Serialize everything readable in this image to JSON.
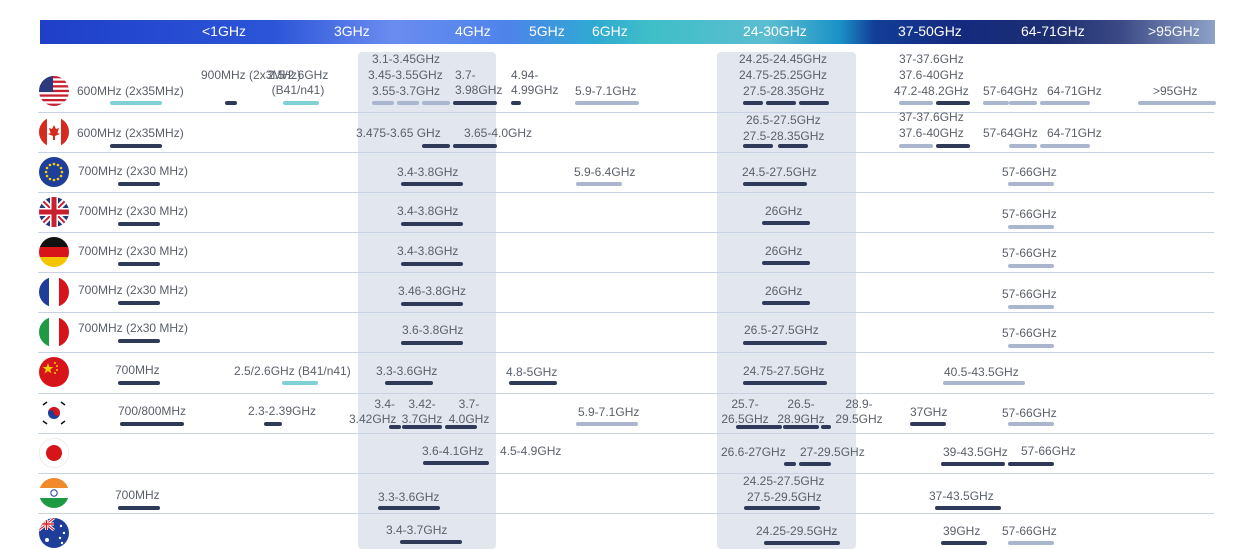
{
  "header": {
    "bands": [
      "<1GHz",
      "3GHz",
      "4GHz",
      "5GHz",
      "6GHz",
      "24-30GHz",
      "37-50GHz",
      "64-71GHz",
      ">95GHz"
    ]
  },
  "colors": {
    "dark_bar": "#2e3a57",
    "light_bar": "#aab6cd",
    "teal_bar": "#7fd1d6",
    "highlight_band": "#e2e7ef"
  },
  "chart_data": {
    "type": "table",
    "rows": [
      {
        "country_flag": "flag-usa-icon",
        "entries": [
          {
            "text": "600MHz (2x35MHz)",
            "tier": "teal"
          },
          {
            "text": "900MHz (2x3MHz)",
            "tier": "dark"
          },
          {
            "text": "2.5/2.6GHz (B41/n41)",
            "tier": "teal"
          },
          {
            "text": "3.1-3.45GHz",
            "tier": "light"
          },
          {
            "text": "3.45-3.55GHz",
            "tier": "light"
          },
          {
            "text": "3.55-3.7GHz",
            "tier": "light"
          },
          {
            "text": "3.7-3.98GHz",
            "tier": "dark"
          },
          {
            "text": "4.94-4.99GHz",
            "tier": "dark"
          },
          {
            "text": "5.9-7.1GHz",
            "tier": "light"
          },
          {
            "text": "24.25-24.45GHz",
            "tier": "dark"
          },
          {
            "text": "24.75-25.25GHz",
            "tier": "dark"
          },
          {
            "text": "27.5-28.35GHz",
            "tier": "dark"
          },
          {
            "text": "37-37.6GHz",
            "tier": "light"
          },
          {
            "text": "37.6-40GHz",
            "tier": "dark"
          },
          {
            "text": "47.2-48.2GHz",
            "tier": "light"
          },
          {
            "text": "57-64GHz",
            "tier": "light"
          },
          {
            "text": "64-71GHz",
            "tier": "light"
          },
          {
            "text": ">95GHz",
            "tier": "light"
          }
        ]
      },
      {
        "country_flag": "flag-canada-icon",
        "entries": [
          {
            "text": "600MHz (2x35MHz)",
            "tier": "dark"
          },
          {
            "text": "3.475-3.65 GHz",
            "tier": "dark"
          },
          {
            "text": "3.65-4.0GHz",
            "tier": "dark"
          },
          {
            "text": "26.5-27.5GHz",
            "tier": "dark"
          },
          {
            "text": "27.5-28.35GHz",
            "tier": "dark"
          },
          {
            "text": "37-37.6GHz",
            "tier": "light"
          },
          {
            "text": "37.6-40GHz",
            "tier": "dark"
          },
          {
            "text": "57-64GHz",
            "tier": "light"
          },
          {
            "text": "64-71GHz",
            "tier": "light"
          }
        ]
      },
      {
        "country_flag": "flag-eu-icon",
        "entries": [
          {
            "text": "700MHz (2x30 MHz)",
            "tier": "dark"
          },
          {
            "text": "3.4-3.8GHz",
            "tier": "dark"
          },
          {
            "text": "5.9-6.4GHz",
            "tier": "light"
          },
          {
            "text": "24.5-27.5GHz",
            "tier": "dark"
          },
          {
            "text": "57-66GHz",
            "tier": "light"
          }
        ]
      },
      {
        "country_flag": "flag-uk-icon",
        "entries": [
          {
            "text": "700MHz (2x30 MHz)",
            "tier": "dark"
          },
          {
            "text": "3.4-3.8GHz",
            "tier": "dark"
          },
          {
            "text": "26GHz",
            "tier": "dark"
          },
          {
            "text": "57-66GHz",
            "tier": "light"
          }
        ]
      },
      {
        "country_flag": "flag-germany-icon",
        "entries": [
          {
            "text": "700MHz (2x30 MHz)",
            "tier": "dark"
          },
          {
            "text": "3.4-3.8GHz",
            "tier": "dark"
          },
          {
            "text": "26GHz",
            "tier": "dark"
          },
          {
            "text": "57-66GHz",
            "tier": "light"
          }
        ]
      },
      {
        "country_flag": "flag-france-icon",
        "entries": [
          {
            "text": "700MHz (2x30 MHz)",
            "tier": "dark"
          },
          {
            "text": "3.46-3.8GHz",
            "tier": "dark"
          },
          {
            "text": "26GHz",
            "tier": "dark"
          },
          {
            "text": "57-66GHz",
            "tier": "light"
          }
        ]
      },
      {
        "country_flag": "flag-italy-icon",
        "entries": [
          {
            "text": "700MHz (2x30 MHz)",
            "tier": "dark"
          },
          {
            "text": "3.6-3.8GHz",
            "tier": "dark"
          },
          {
            "text": "26.5-27.5GHz",
            "tier": "dark"
          },
          {
            "text": "57-66GHz",
            "tier": "light"
          }
        ]
      },
      {
        "country_flag": "flag-china-icon",
        "entries": [
          {
            "text": "700MHz",
            "tier": "dark"
          },
          {
            "text": "2.5/2.6GHz (B41/n41)",
            "tier": "teal"
          },
          {
            "text": "3.3-3.6GHz",
            "tier": "dark"
          },
          {
            "text": "4.8-5GHz",
            "tier": "dark"
          },
          {
            "text": "24.75-27.5GHz",
            "tier": "dark"
          },
          {
            "text": "40.5-43.5GHz",
            "tier": "light"
          }
        ]
      },
      {
        "country_flag": "flag-korea-icon",
        "entries": [
          {
            "text": "700/800MHz",
            "tier": "dark"
          },
          {
            "text": "2.3-2.39GHz",
            "tier": "dark"
          },
          {
            "text": "3.4-3.42GHz",
            "tier": "dark"
          },
          {
            "text": "3.42-3.7GHz",
            "tier": "dark"
          },
          {
            "text": "3.7-4.0GHz",
            "tier": "dark"
          },
          {
            "text": "5.9-7.1GHz",
            "tier": "light"
          },
          {
            "text": "25.7-26.5GHz",
            "tier": "dark"
          },
          {
            "text": "26.5-28.9GHz",
            "tier": "dark"
          },
          {
            "text": "28.9-29.5GHz",
            "tier": "dark"
          },
          {
            "text": "37GHz",
            "tier": "dark"
          },
          {
            "text": "57-66GHz",
            "tier": "light"
          }
        ]
      },
      {
        "country_flag": "flag-japan-icon",
        "entries": [
          {
            "text": "3.6-4.1GHz",
            "tier": "dark"
          },
          {
            "text": "4.5-4.9GHz",
            "tier": "dark"
          },
          {
            "text": "26.6-27GHz",
            "tier": "dark"
          },
          {
            "text": "27-29.5GHz",
            "tier": "dark"
          },
          {
            "text": "39-43.5GHz",
            "tier": "dark"
          },
          {
            "text": "57-66GHz",
            "tier": "light"
          }
        ]
      },
      {
        "country_flag": "flag-india-icon",
        "entries": [
          {
            "text": "700MHz",
            "tier": "dark"
          },
          {
            "text": "3.3-3.6GHz",
            "tier": "dark"
          },
          {
            "text": "24.25-27.5GHz",
            "tier": "dark"
          },
          {
            "text": "27.5-29.5GHz",
            "tier": "dark"
          },
          {
            "text": "37-43.5GHz",
            "tier": "dark"
          }
        ]
      },
      {
        "country_flag": "flag-australia-icon",
        "entries": [
          {
            "text": "3.4-3.7GHz",
            "tier": "dark"
          },
          {
            "text": "24.25-29.5GHz",
            "tier": "dark"
          },
          {
            "text": "39GHz",
            "tier": "dark"
          },
          {
            "text": "57-66GHz",
            "tier": "light"
          }
        ]
      }
    ]
  }
}
